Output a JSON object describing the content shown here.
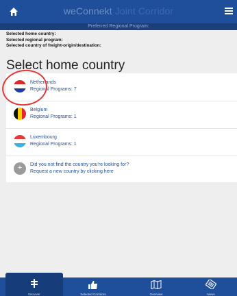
{
  "header": {
    "title_part1": "weConnekt",
    "title_part2": " Joint Corridor",
    "subtitle": "Preferred Regional Program:"
  },
  "info": {
    "line1": "Selected home country:",
    "line2": "Selected regional program:",
    "line3": "Selected country of freight-origin/destination:"
  },
  "heading": "Select home country",
  "countries": [
    {
      "name": "Netherlands",
      "programs": "Regional Programs: 7"
    },
    {
      "name": "Belgium",
      "programs": "Regional Programs: 1"
    },
    {
      "name": "Luxembourg",
      "programs": "Regional Programs: 1"
    }
  ],
  "request": {
    "line1": "Did you not find the country you're looking for?",
    "line2": "Request a new country by clicking here"
  },
  "tabs": [
    {
      "label": "Discover"
    },
    {
      "label": "Selected Corridors"
    },
    {
      "label": "Overview"
    },
    {
      "label": "News"
    }
  ],
  "colors": {
    "primary": "#1f4f9a",
    "annotation": "#e23a3a"
  }
}
